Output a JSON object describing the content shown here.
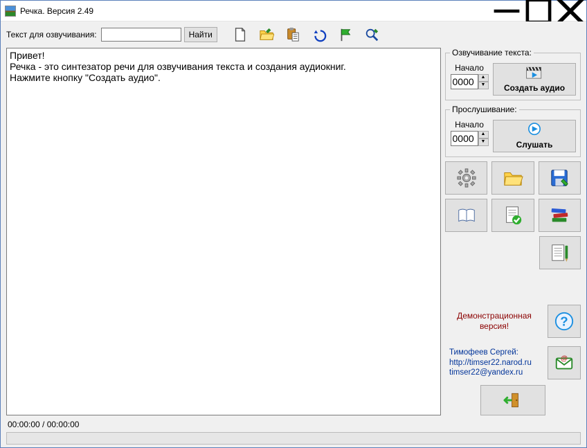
{
  "window": {
    "title": "Речка. Версия 2.49"
  },
  "toolbar": {
    "search_label": "Текст для озвучивания:",
    "search_value": "",
    "find_button": "Найти"
  },
  "editor": {
    "text": "Привет!\nРечка - это синтезатор речи для озвучивания текста и создания аудиокниг.\nНажмите кнопку \"Создать аудио\"."
  },
  "tts": {
    "legend": "Озвучивание текста:",
    "start_label": "Начало",
    "start_value": "0000",
    "action_label": "Создать аудио"
  },
  "listen": {
    "legend": "Прослушивание:",
    "start_label": "Начало",
    "start_value": "0000",
    "action_label": "Слушать"
  },
  "demo": {
    "line1": "Демонстрационная",
    "line2": "версия!"
  },
  "contact": {
    "name": "Тимофеев Сергей:",
    "url": "http://timser22.narod.ru",
    "email": "timser22@yandex.ru"
  },
  "status": {
    "time": "00:00:00 / 00:00:00"
  },
  "icons": {
    "new": "new-file-icon",
    "open": "open-folder-icon",
    "paste": "paste-icon",
    "undo": "undo-icon",
    "flag": "flag-icon",
    "search": "search-icon",
    "clapper": "clapperboard-icon",
    "play": "play-icon",
    "gear": "gear-icon",
    "folder": "folder-icon",
    "save": "save-icon",
    "book": "book-icon",
    "doc_ok": "document-check-icon",
    "books": "books-stack-icon",
    "notepad": "notepad-pen-icon",
    "help": "help-icon",
    "mail": "email-icon",
    "exit": "exit-icon"
  }
}
